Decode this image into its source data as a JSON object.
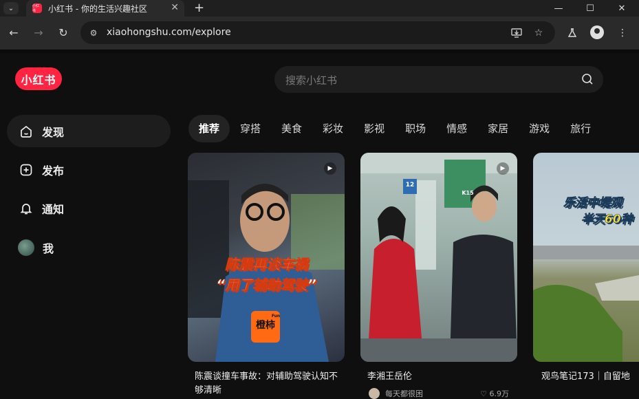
{
  "browser": {
    "tab_title": "小红书 - 你的生活兴趣社区",
    "favicon_text": "小红书",
    "url": "xiaohongshu.com/explore"
  },
  "app": {
    "logo": "小红书",
    "search_placeholder": "搜索小红书"
  },
  "sidebar": {
    "items": [
      {
        "label": "发现",
        "icon": "home-icon"
      },
      {
        "label": "发布",
        "icon": "plus-square-icon"
      },
      {
        "label": "通知",
        "icon": "bell-icon"
      },
      {
        "label": "我",
        "icon": "avatar"
      }
    ]
  },
  "categories": [
    "推荐",
    "穿搭",
    "美食",
    "彩妆",
    "影视",
    "职场",
    "情感",
    "家居",
    "游戏",
    "旅行"
  ],
  "feed": [
    {
      "title": "陈震谈撞车事故：对辅助驾驶认知不够清晰",
      "overlay_line1": "陈震再谈车祸",
      "overlay_line2": "“用了辅助驾驶”",
      "brand": "橙柿",
      "brand_sub": "Fun",
      "author": "",
      "likes": ""
    },
    {
      "title": "李湘王岳伦",
      "author": "每天都很困",
      "likes": "6.9万",
      "sign_number": "12",
      "sign_code": "K15"
    },
    {
      "title": "观鸟笔记173｜自留地",
      "overlay_line1": "乐活中堤观",
      "overlay_line2": "半天60种",
      "author": "",
      "likes": ""
    }
  ]
}
